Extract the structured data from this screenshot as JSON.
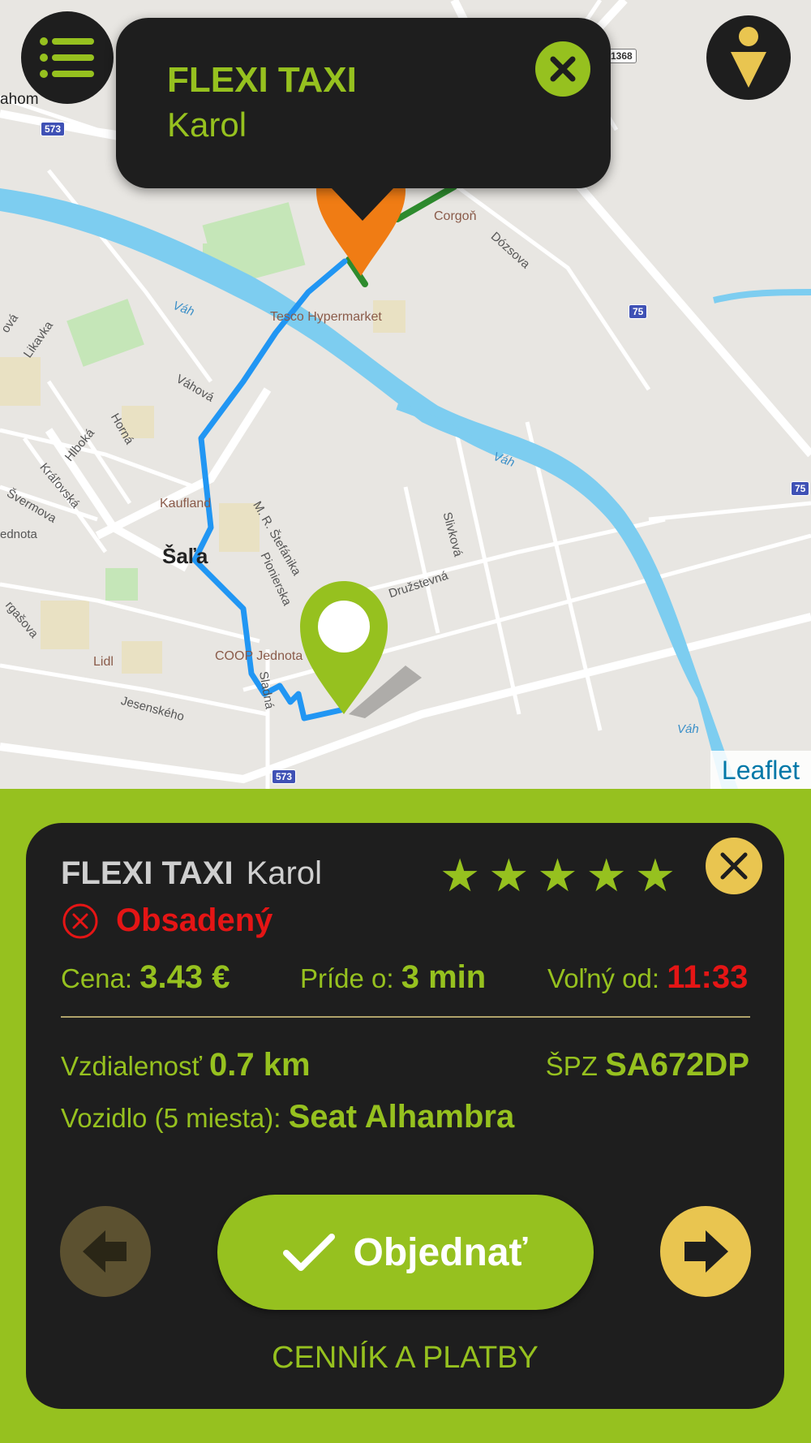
{
  "map": {
    "labels": {
      "town_name": "Šaľa",
      "hom": "ahom",
      "corgon": "Corgoň",
      "dozsova": "Dózsova",
      "tesco": "Tesco Hypermarket",
      "vah1": "Váh",
      "vah2": "Váh",
      "vah3": "Váh",
      "vahova": "Váhová",
      "likavka": "Likavka",
      "ova": "ová",
      "hlboka": "Hlboká",
      "horna": "Horná",
      "kralovska": "Kráľovská",
      "svermova": "Švermova",
      "ednota": "ednota",
      "kaufland": "Kaufland",
      "stefanika": "M. R. Štefánika",
      "pionierska": "Pionierska",
      "slivkova": "Slivková",
      "druzstevna": "Družstevná",
      "rgasova": "rgašova",
      "lidl": "Lidl",
      "coop": "COOP Jednota",
      "jesenskeho": "Jesenského",
      "sladna": "Sladná"
    },
    "shields": {
      "s573a": "573",
      "s1368": "1368",
      "s75a": "75",
      "s75b": "75",
      "s573b": "573"
    },
    "attribution": "Leaflet"
  },
  "popup": {
    "title": "FLEXI TAXI",
    "subtitle": "Karol"
  },
  "card": {
    "company": "FLEXI TAXI",
    "driver": "Karol",
    "rating": 5,
    "status": "Obsadený",
    "price_label": "Cena:",
    "price_value": "3.43 €",
    "arrival_label": "Príde o:",
    "arrival_value": "3 min",
    "free_label": "Voľný od:",
    "free_value": "11:33",
    "distance_label": "Vzdialenosť",
    "distance_value": "0.7 km",
    "plate_label": "ŠPZ",
    "plate_value": "SA672DP",
    "vehicle_label": "Vozidlo (5 miesta):",
    "vehicle_value": "Seat Alhambra",
    "order_label": "Objednať",
    "pricing_link": "CENNÍK A PLATBY"
  },
  "colors": {
    "accent": "#96c11f",
    "dark": "#1e1e1e",
    "yellow": "#e9c550",
    "status_red": "#e51515",
    "route_blue": "#2196f3",
    "taxi_orange": "#f07c14"
  },
  "icons": {
    "menu": "menu-icon",
    "person": "person-icon",
    "close": "close-icon",
    "star": "star-icon",
    "status": "cancel-circle-icon",
    "check": "check-icon",
    "prev": "arrow-left-icon",
    "next": "arrow-right-icon",
    "taxi_marker": "taxi-marker-icon",
    "destination_marker": "destination-pin-icon"
  }
}
